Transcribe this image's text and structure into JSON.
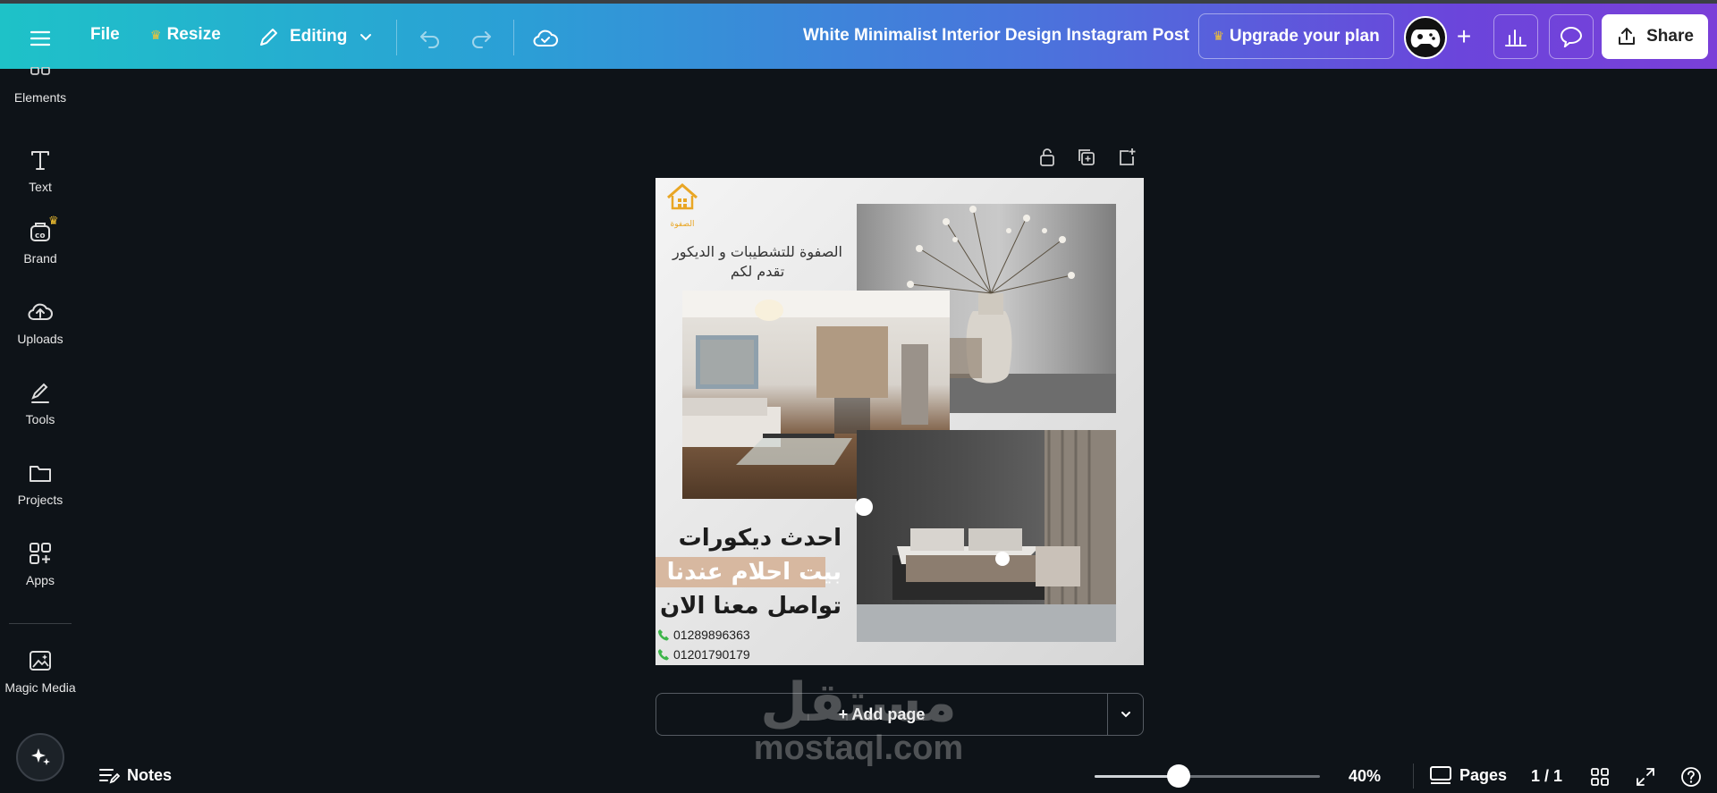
{
  "topbar": {
    "file_label": "File",
    "resize_label": "Resize",
    "editing_label": "Editing",
    "title": "White Minimalist Interior Design Instagram Post",
    "upgrade_label": "Upgrade your plan",
    "share_label": "Share"
  },
  "sidebar": {
    "items": [
      {
        "label": "Elements"
      },
      {
        "label": "Text"
      },
      {
        "label": "Brand"
      },
      {
        "label": "Uploads"
      },
      {
        "label": "Tools"
      },
      {
        "label": "Projects"
      },
      {
        "label": "Apps"
      },
      {
        "label": "Magic Media"
      }
    ]
  },
  "design": {
    "logo_text": "الصفوة",
    "intro_line1": "الصفوة للتشطيبات و الديكور",
    "intro_line2": "تقدم لكم",
    "headline1": "احدث ديكورات",
    "headline2": "بيت احلام عندنا",
    "headline3": "تواصل معنا الان",
    "phone1": "01289896363",
    "phone2": "01201790179"
  },
  "canvas": {
    "add_page_label": "+ Add page"
  },
  "bottombar": {
    "notes_label": "Notes",
    "zoom_label": "40%",
    "zoom_fraction": 0.4,
    "pages_label": "Pages",
    "page_count": "1 / 1"
  },
  "watermark": {
    "arabic": "مستقل",
    "latin": "mostaql.com"
  },
  "colors": {
    "accent_gold": "#e9a624",
    "headline_band": "#d7b8a0",
    "phone_green": "#3db54a"
  }
}
